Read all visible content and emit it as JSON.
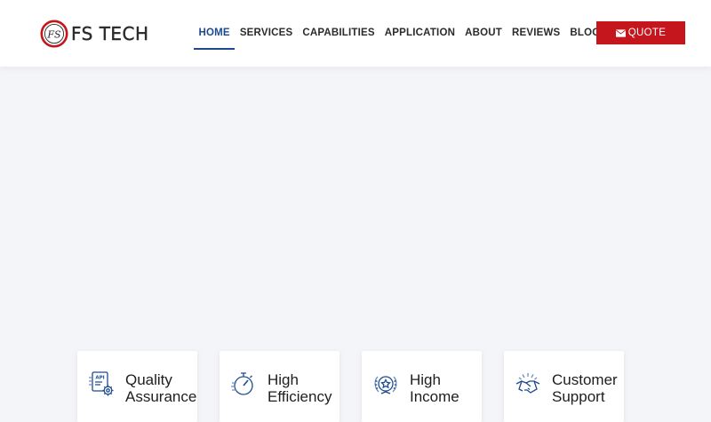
{
  "brand": {
    "name": "FS TECH",
    "colors": {
      "primary": "#1d4a8f",
      "accent": "#c4161c",
      "text": "#2b2b2b"
    }
  },
  "nav": {
    "items": [
      {
        "label": "HOME",
        "active": true
      },
      {
        "label": "SERVICES",
        "active": false
      },
      {
        "label": "CAPABILITIES",
        "active": false
      },
      {
        "label": "APPLICATION",
        "active": false
      },
      {
        "label": "ABOUT",
        "active": false
      },
      {
        "label": "REVIEWS",
        "active": false
      },
      {
        "label": "BLOG",
        "active": false
      }
    ]
  },
  "header": {
    "quote_label": "QUOTE",
    "quote_icon": "envelope-icon"
  },
  "features": [
    {
      "title": "Quality Assurance",
      "icon": "api-gear-icon"
    },
    {
      "title": "High Efficiency",
      "icon": "stopwatch-icon"
    },
    {
      "title": "High Income",
      "icon": "laurel-star-icon"
    },
    {
      "title": "Customer Support",
      "icon": "handshake-icon"
    }
  ]
}
